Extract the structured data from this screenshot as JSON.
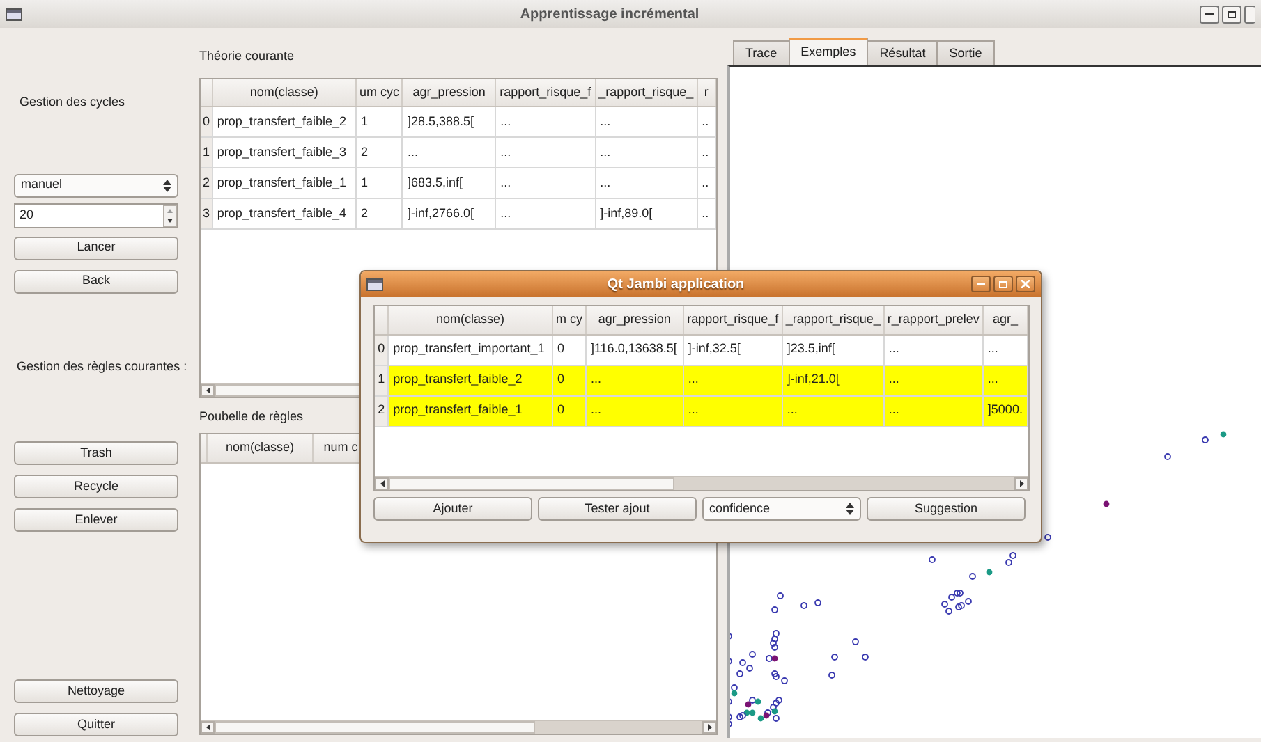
{
  "window": {
    "title": "Apprentissage incrémental"
  },
  "cycle_management": {
    "label": "Gestion des cycles",
    "mode": "manuel",
    "count": "20",
    "buttons": [
      "Lancer",
      "Back"
    ]
  },
  "rules_management": {
    "label": "Gestion des règles courantes :",
    "buttons": [
      "Trash",
      "Recycle",
      "Enlever"
    ]
  },
  "bottom_buttons": [
    "Nettoyage",
    "Quitter"
  ],
  "current_theory": {
    "title": "Théorie courante",
    "columns": [
      "nom(classe)",
      "um cyc",
      "agr_pression",
      "rapport_risque_f",
      "_rapport_risque_",
      "r"
    ],
    "rows": [
      {
        "index": "0",
        "cells": [
          "prop_transfert_faible_2",
          "1",
          "]28.5,388.5[",
          "...",
          "...",
          ".."
        ]
      },
      {
        "index": "1",
        "cells": [
          "prop_transfert_faible_3",
          "2",
          "...",
          "...",
          "...",
          ".."
        ]
      },
      {
        "index": "2",
        "cells": [
          "prop_transfert_faible_1",
          "1",
          "]683.5,inf[",
          "...",
          "...",
          ".."
        ]
      },
      {
        "index": "3",
        "cells": [
          "prop_transfert_faible_4",
          "2",
          "]-inf,2766.0[",
          "...",
          "]-inf,89.0[",
          ".."
        ]
      }
    ]
  },
  "rule_bin": {
    "title": "Poubelle de règles",
    "columns": [
      "nom(classe)",
      "num c"
    ]
  },
  "tabs": [
    {
      "label": "Trace",
      "selected": false
    },
    {
      "label": "Exemples",
      "selected": true
    },
    {
      "label": "Résultat",
      "selected": false
    },
    {
      "label": "Sortie",
      "selected": false
    }
  ],
  "dialog": {
    "title": "Qt Jambi application",
    "columns": [
      "nom(classe)",
      "m cy",
      "agr_pression",
      "rapport_risque_f",
      "_rapport_risque_",
      "r_rapport_prelev",
      "agr_"
    ],
    "rows": [
      {
        "index": "0",
        "highlighted": false,
        "cells": [
          "prop_transfert_important_1",
          "0",
          "]116.0,13638.5[",
          "]-inf,32.5[",
          "]23.5,inf[",
          "...",
          "..."
        ]
      },
      {
        "index": "1",
        "highlighted": true,
        "cells": [
          "prop_transfert_faible_2",
          "0",
          "...",
          "...",
          "]-inf,21.0[",
          "...",
          "..."
        ]
      },
      {
        "index": "2",
        "highlighted": true,
        "cells": [
          "prop_transfert_faible_1",
          "0",
          "...",
          "...",
          "...",
          "...",
          "]5000."
        ]
      }
    ],
    "buttons": [
      "Ajouter",
      "Tester ajout"
    ],
    "metric": "confidence",
    "suggest_button": "Suggestion"
  }
}
